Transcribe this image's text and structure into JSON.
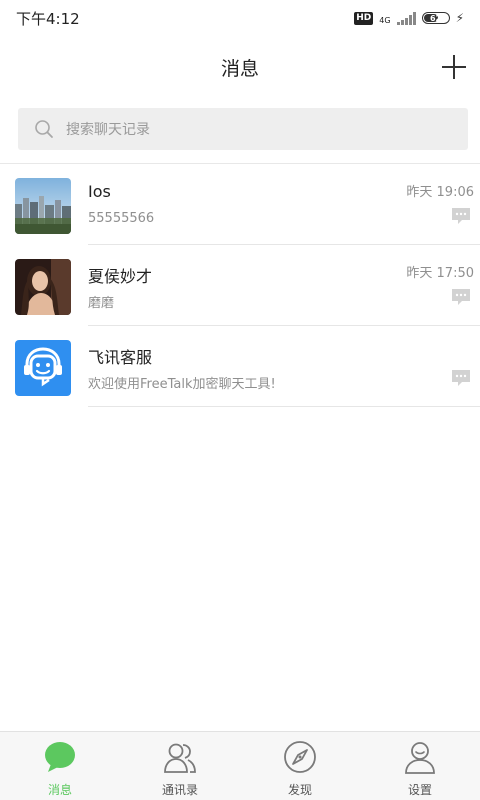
{
  "status": {
    "time": "下午4:12",
    "hd": "HD",
    "network": "4G",
    "battery": "62",
    "battery_level": 0.62
  },
  "header": {
    "title": "消息"
  },
  "search": {
    "placeholder": "搜索聊天记录"
  },
  "chats": [
    {
      "name": "Ios",
      "preview": "55555566",
      "time": "昨天 19:06",
      "avatar": "city-skyline-photo"
    },
    {
      "name": "夏侯妙才",
      "preview": "磨磨",
      "time": "昨天 17:50",
      "avatar": "woman-portrait-photo"
    },
    {
      "name": "飞讯客服",
      "preview": "欢迎使用FreeTalk加密聊天工具!",
      "time": "",
      "avatar": "customer-service-headset-icon"
    }
  ],
  "tabs": [
    {
      "label": "消息",
      "icon": "chat-bubble-icon",
      "active": true
    },
    {
      "label": "通讯录",
      "icon": "contacts-icon",
      "active": false
    },
    {
      "label": "发现",
      "icon": "compass-icon",
      "active": false
    },
    {
      "label": "设置",
      "icon": "user-settings-icon",
      "active": false
    }
  ],
  "colors": {
    "accent": "#5cc85f",
    "service_blue": "#2f8ff0",
    "icon_gray": "#7a7a7a"
  }
}
